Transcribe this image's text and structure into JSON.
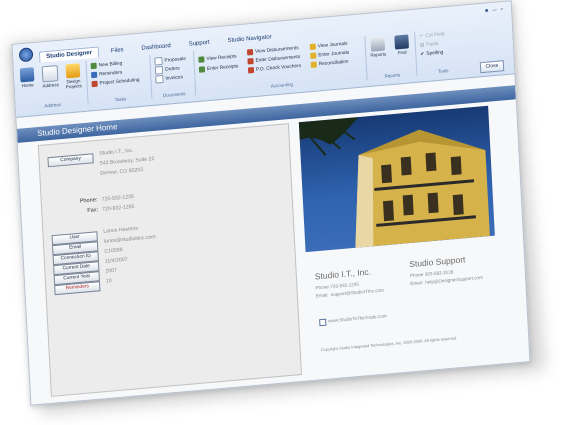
{
  "ribbon": {
    "tabs": [
      "Studio Designer",
      "Files",
      "Dashboard",
      "Support",
      "Studio Navigator"
    ],
    "groups": {
      "address_label": "Address",
      "tasks_label": "Tasks",
      "documents_label": "Documents",
      "accounting_label": "Accounting",
      "reports_label": "Reports",
      "tools_label": "Tools"
    },
    "buttons": {
      "home": "Home",
      "address": "Address",
      "design_projects": "Design Projects",
      "new_billing": "New Billing",
      "reminders": "Reminders",
      "project_scheduling": "Project Scheduling",
      "proposals": "Proposals",
      "orders": "Orders",
      "invoices": "Invoices",
      "view_receipts": "View Receipts",
      "enter_receipts": "Enter Receipts",
      "view_disbursements": "View Disbursements",
      "enter_disbursements": "Enter Disbursements",
      "po_check_vouchers": "P.O. Check Vouchers",
      "view_journals": "View Journals",
      "enter_journals": "Enter Journals",
      "reconciliation": "Reconciliation",
      "reports": "Reports",
      "find": "Find",
      "cut": "Cut Field",
      "paste": "Paste",
      "spelling": "Spelling"
    },
    "close": "Close"
  },
  "header": {
    "title": "Studio Designer Home"
  },
  "left": {
    "company_button": "Company",
    "company_lines": [
      "Studio I.T., Inc.",
      "543 Broadway, Suite 22",
      "Denver, CO 80203"
    ],
    "phone_label": "Phone:",
    "phone": "720-932-1235",
    "fax_label": "Fax:",
    "fax": "720-932-1265",
    "user_fields": [
      {
        "label": "User",
        "value": "Lance Hastens"
      },
      {
        "label": "Email",
        "value": "lance@studioitinc.com"
      },
      {
        "label": "Connection ID",
        "value": "C10589"
      },
      {
        "label": "Current Date",
        "value": "11/4/2007"
      },
      {
        "label": "Current Year",
        "value": "2007"
      },
      {
        "label": "Reminders",
        "value": "10"
      }
    ]
  },
  "right": {
    "company": {
      "title": "Studio I.T., Inc.",
      "phone_label": "Phone:",
      "phone": "720-932-1235",
      "email_label": "Email:",
      "email": "support@StudioITInc.com"
    },
    "support": {
      "title": "Studio Support",
      "phone_label": "Phone:",
      "phone": "303-682-3128",
      "email_label": "Email:",
      "email": "help@DesignerSupport.com"
    },
    "checkbox_label": "www.StudioToTheTrade.com",
    "copyright": "Copyright Studio Integrated Technologies, Inc. 2000-2008. All rights reserved."
  },
  "colors": {
    "accent": "#3e659f",
    "ribbon": "#d6e3f5"
  }
}
